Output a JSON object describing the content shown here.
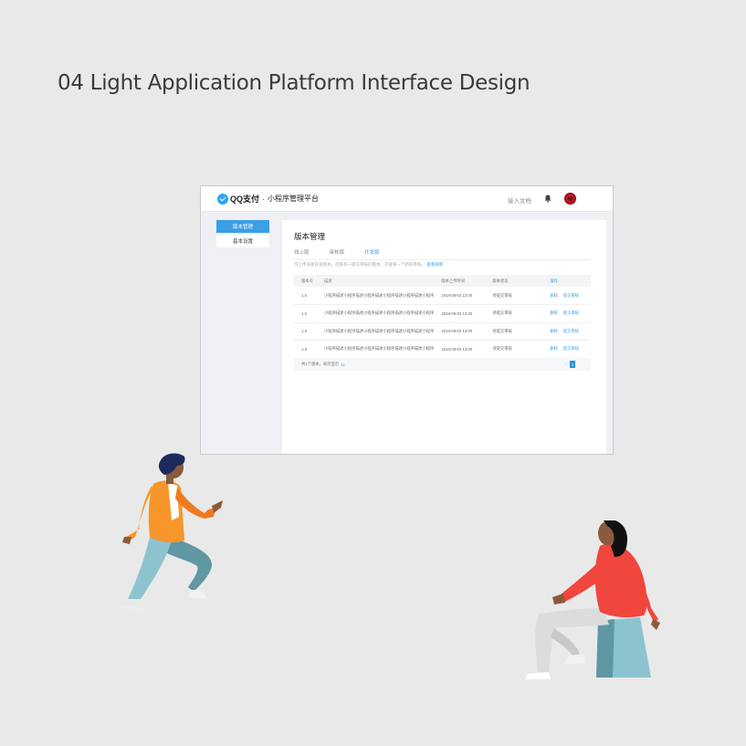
{
  "heading": "04 Light Application Platform Interface Design",
  "app": {
    "brand": "QQ支付",
    "separator": "·",
    "platform_title": "小程序管理平台",
    "doc_link": "接入文档",
    "icons": {
      "bell": "bell-icon",
      "avatar": "avatar"
    }
  },
  "sidebar": {
    "items": [
      {
        "label": "版本管理",
        "active": true
      },
      {
        "label": "基本设置",
        "active": false
      }
    ]
  },
  "main": {
    "title": "版本管理",
    "tabs": [
      {
        "label": "线上版",
        "active": false
      },
      {
        "label": "审核版",
        "active": false
      },
      {
        "label": "开发版",
        "active": true
      }
    ],
    "hint": "可上传多版开发版本，选择其一提交审核的版本，可查看一个新的审核。",
    "hint_link": "查看规则",
    "table": {
      "headers": [
        "版本号",
        "描述",
        "版本上传时间",
        "版本状态",
        "操作"
      ],
      "rows": [
        {
          "version": "1.6",
          "desc": "小程序描述小程序描述小程序描述小程序描述小程序描述小程序",
          "time": "2018-08-03 13:00",
          "status": "待提交审核",
          "op1": "删除",
          "op2": "提交审核"
        },
        {
          "version": "1.6",
          "desc": "小程序描述小程序描述小程序描述小程序描述小程序描述小程序",
          "time": "2018-08-03 13:00",
          "status": "待提交审核",
          "op1": "删除",
          "op2": "提交审核"
        },
        {
          "version": "1.6",
          "desc": "小程序描述小程序描述小程序描述小程序描述小程序描述小程序",
          "time": "2018-08-03 13:00",
          "status": "待提交审核",
          "op1": "删除",
          "op2": "提交审核"
        },
        {
          "version": "1.6",
          "desc": "小程序描述小程序描述小程序描述小程序描述小程序描述小程序",
          "time": "2018-08-03 13:00",
          "status": "待提交审核",
          "op1": "删除",
          "op2": "提交审核"
        }
      ],
      "footer_text": "共1个版本，每页显示",
      "footer_count": "11",
      "pager_prev": "‹",
      "pager_current": "1"
    }
  },
  "colors": {
    "accent": "#3b9fe6",
    "background": "#e9e9e9",
    "avatar": "#c0151d"
  }
}
